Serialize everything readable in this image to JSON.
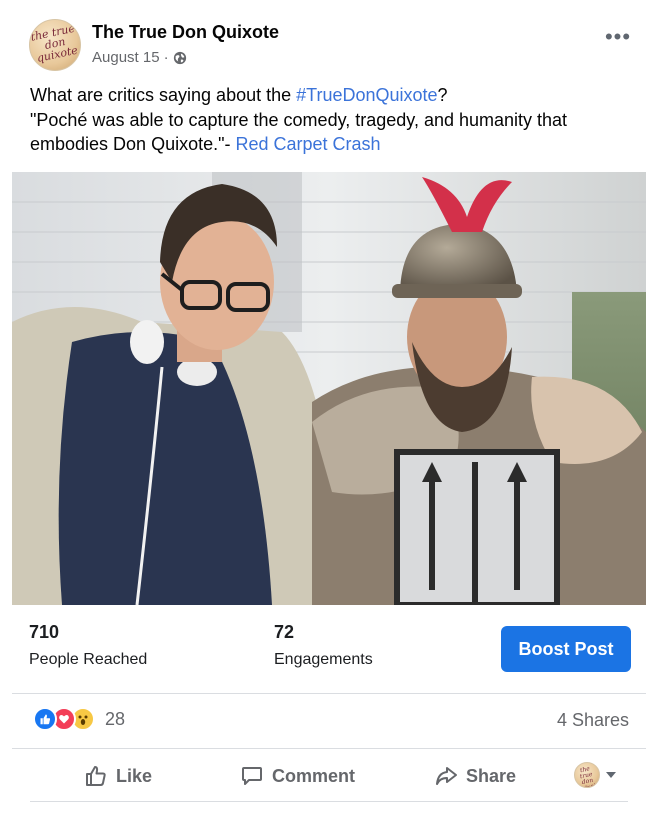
{
  "page": {
    "name": "The True Don Quixote",
    "avatar_text": "the true don quixote"
  },
  "post": {
    "date": "August 15",
    "separator": "·",
    "audience_icon": "globe-icon",
    "more_label": "•••",
    "text_prefix": "What are critics saying about the ",
    "hashtag": "#TrueDonQuixote",
    "text_after_hashtag": "?",
    "quote": "\"Poché was able to capture the comedy, tragedy, and humanity that embodies Don Quixote.\"- ",
    "quote_source": "Red Carpet Crash",
    "photo_alt": "Photo of two men, one in armor with a red-plumed helmet"
  },
  "stats": {
    "reached_value": "710",
    "reached_label": "People Reached",
    "engagements_value": "72",
    "engagements_label": "Engagements",
    "boost_label": "Boost Post"
  },
  "reactions": {
    "icons": [
      "like-icon",
      "love-icon",
      "wow-icon"
    ],
    "count": "28",
    "shares": "4 Shares"
  },
  "actions": {
    "like": "Like",
    "comment": "Comment",
    "share": "Share"
  },
  "colors": {
    "link": "#3b73d9",
    "boost": "#1b74e4",
    "like": "#1877f2",
    "love": "#f33e58",
    "wow": "#f7c844"
  }
}
